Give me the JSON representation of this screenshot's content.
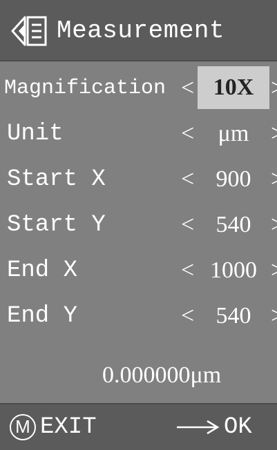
{
  "colors": {
    "panel_bg": "#808080",
    "bar_bg": "#5b5b5b",
    "selected_bg": "#cdcdcd",
    "text": "#ffffff"
  },
  "header": {
    "icon": "back-icon",
    "title": "Measurement"
  },
  "rows": [
    {
      "label": "Magnification",
      "value": "10X",
      "selected": true
    },
    {
      "label": "Unit",
      "value": "μm",
      "selected": false
    },
    {
      "label": "Start X",
      "value": "900",
      "selected": false
    },
    {
      "label": "Start Y",
      "value": "540",
      "selected": false
    },
    {
      "label": "End X",
      "value": "1000",
      "selected": false
    },
    {
      "label": "End Y",
      "value": "540",
      "selected": false
    }
  ],
  "arrows": {
    "left": "<",
    "right": ">"
  },
  "result": "0.000000μm",
  "footer": {
    "m_icon": "M",
    "exit_label": "EXIT",
    "arrow_icon": "arrow-right-icon",
    "ok_label": "OK"
  }
}
